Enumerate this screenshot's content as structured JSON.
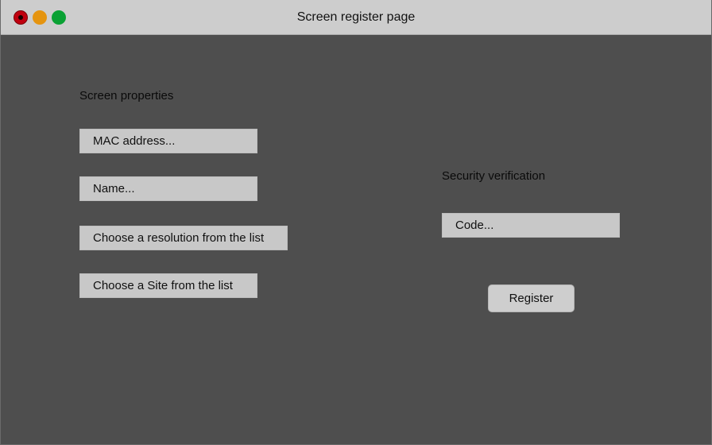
{
  "window": {
    "title": "Screen register page"
  },
  "screen_properties": {
    "heading": "Screen properties",
    "mac_address_placeholder": "MAC address...",
    "name_placeholder": "Name...",
    "resolution_placeholder": "Choose a resolution from the list",
    "site_placeholder": "Choose a Site from the list"
  },
  "security": {
    "heading": "Security verification",
    "code_placeholder": "Code..."
  },
  "actions": {
    "register_label": "Register"
  },
  "colors": {
    "background": "#4e4e4e",
    "titlebar": "#cdcdcd",
    "field": "#c8c8c8",
    "close": "#c0000f",
    "minimize": "#e5940f",
    "maximize": "#0aa134"
  }
}
